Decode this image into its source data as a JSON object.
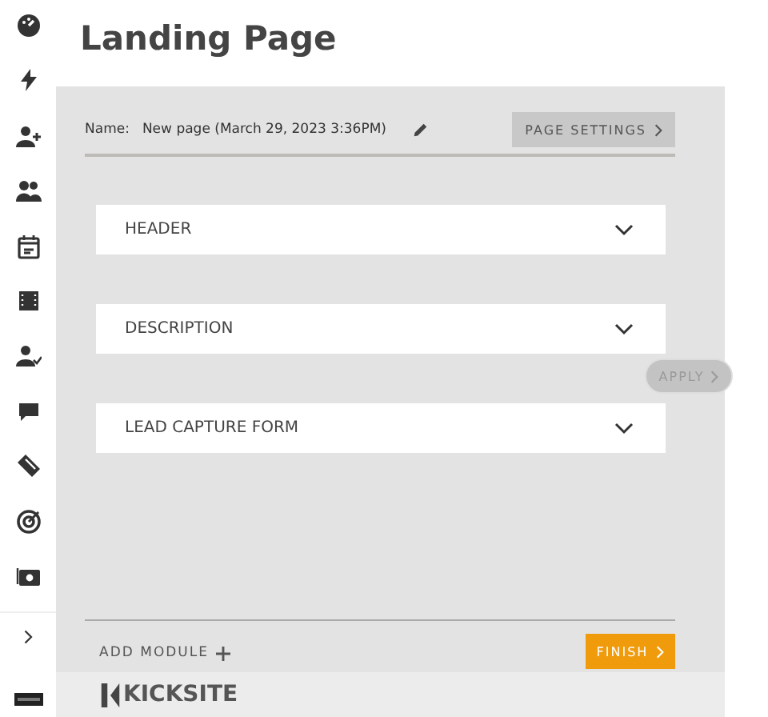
{
  "page_title": "Landing Page",
  "name_row": {
    "label": "Name:",
    "value": "New page (March 29, 2023  3:36PM)"
  },
  "settings_button": {
    "label": "PAGE SETTINGS"
  },
  "modules": [
    {
      "label": "HEADER",
      "expanded": false
    },
    {
      "label": "DESCRIPTION",
      "expanded": false
    },
    {
      "label": "LEAD CAPTURE FORM",
      "expanded": false
    }
  ],
  "apply_button": {
    "label": "APPLY",
    "disabled": true
  },
  "add_module": {
    "label": "ADD MODULE"
  },
  "finish_button": {
    "label": "FINISH"
  },
  "footer": {
    "logo": "KICKSITE"
  }
}
